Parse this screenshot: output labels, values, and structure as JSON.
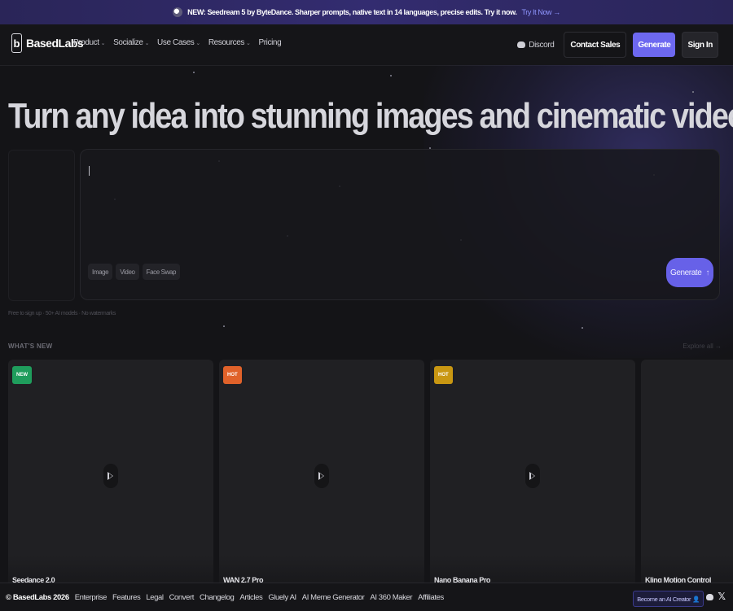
{
  "announcement": {
    "text": "NEW: Seedream 5 by ByteDance. Sharper prompts, native text in 14 languages, precise edits. Try it now.",
    "link": "Try It Now →"
  },
  "header": {
    "logo": "BasedLabs",
    "nav": [
      {
        "label": "Product",
        "dropdown": true
      },
      {
        "label": "Socialize",
        "dropdown": true
      },
      {
        "label": "Use Cases",
        "dropdown": true
      },
      {
        "label": "Resources",
        "dropdown": true
      },
      {
        "label": "Pricing",
        "dropdown": false
      }
    ],
    "discord": "Discord",
    "contact": "Contact Sales",
    "generate": "Generate",
    "signin": "Sign In"
  },
  "hero": {
    "title": "Turn any idea into stunning images and cinematic video",
    "chips": [
      "Image",
      "Video",
      "Face Swap"
    ],
    "generate": "Generate",
    "note": "Free to sign up · 50+ AI models · No watermarks"
  },
  "whats_new": {
    "heading": "WHAT'S NEW",
    "explore": "Explore all →",
    "cards": [
      {
        "badge": "NEW",
        "badge_color": "#1f9d5c",
        "title": "Seedance 2.0"
      },
      {
        "badge": "HOT",
        "badge_color": "#e0622a",
        "title": "WAN 2.7 Pro"
      },
      {
        "badge": "HOT",
        "badge_color": "#c99712",
        "title": "Nano Banana Pro"
      },
      {
        "badge": "",
        "badge_color": "",
        "title": "Kling Motion Control"
      }
    ]
  },
  "footer": {
    "copyright": "© BasedLabs 2026",
    "links": [
      "Enterprise",
      "Features",
      "Legal",
      "Convert",
      "Changelog",
      "Articles",
      "Gluely AI",
      "AI Meme Generator",
      "AI 360 Maker",
      "Affiliates"
    ],
    "creator": "Become an AI Creator"
  }
}
